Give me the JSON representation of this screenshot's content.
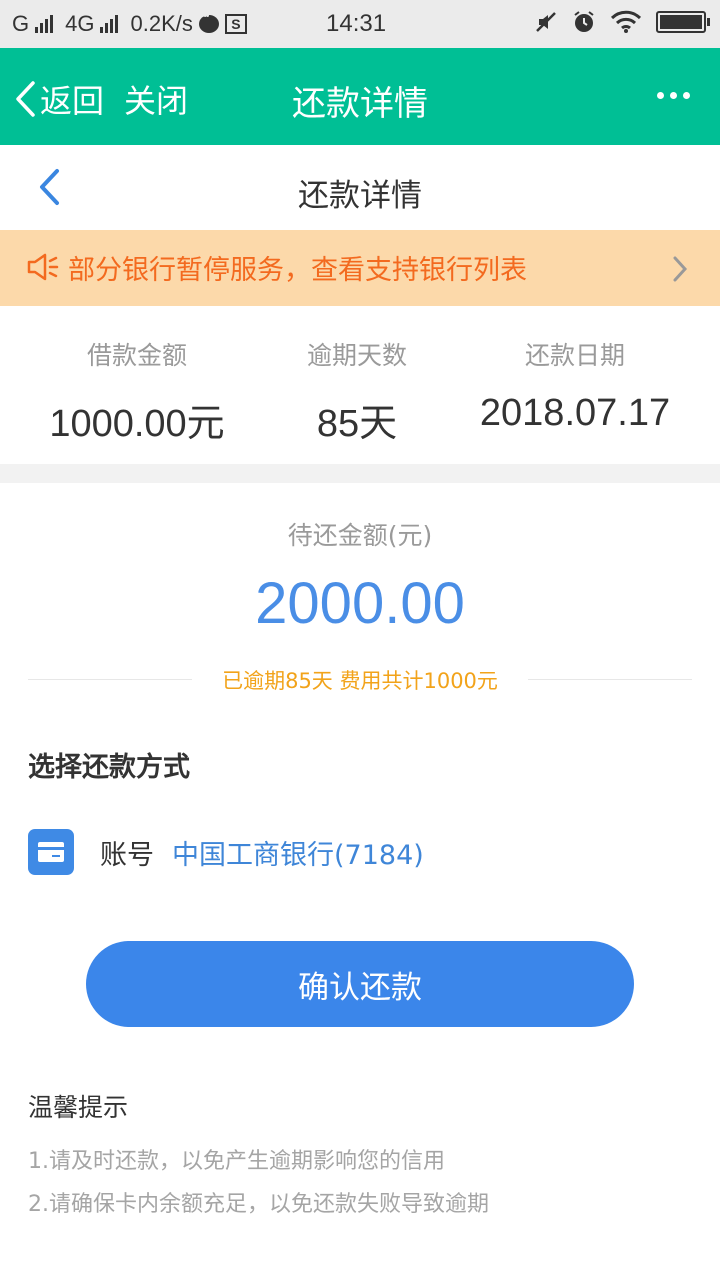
{
  "status_bar": {
    "carrier1": "G",
    "carrier2": "4G",
    "speed": "0.2K/s",
    "time": "14:31"
  },
  "app_header": {
    "back_label": "返回",
    "close_label": "关闭",
    "title": "还款详情",
    "color": "#00bf95"
  },
  "inner_nav": {
    "title": "还款详情"
  },
  "notice": {
    "text": "部分银行暂停服务，查看支持银行列表",
    "icon": "speaker-icon"
  },
  "summary": [
    {
      "label": "借款金额",
      "value": "1000.00元"
    },
    {
      "label": "逾期天数",
      "value": "85天"
    },
    {
      "label": "还款日期",
      "value": "2018.07.17"
    }
  ],
  "pending": {
    "label": "待还金额(元)",
    "amount": "2000.00",
    "overdue_note": "已逾期85天 费用共计1000元"
  },
  "payment_method": {
    "title": "选择还款方式",
    "account_label": "账号",
    "bank": "中国工商银行(7184)",
    "icon": "bank-card-icon"
  },
  "confirm_button": {
    "label": "确认还款",
    "color": "#3b86ea"
  },
  "tips": {
    "title": "温馨提示",
    "items": [
      "1.请及时还款，以免产生逾期影响您的信用",
      "2.请确保卡内余额充足，以免还款失败导致逾期"
    ]
  }
}
